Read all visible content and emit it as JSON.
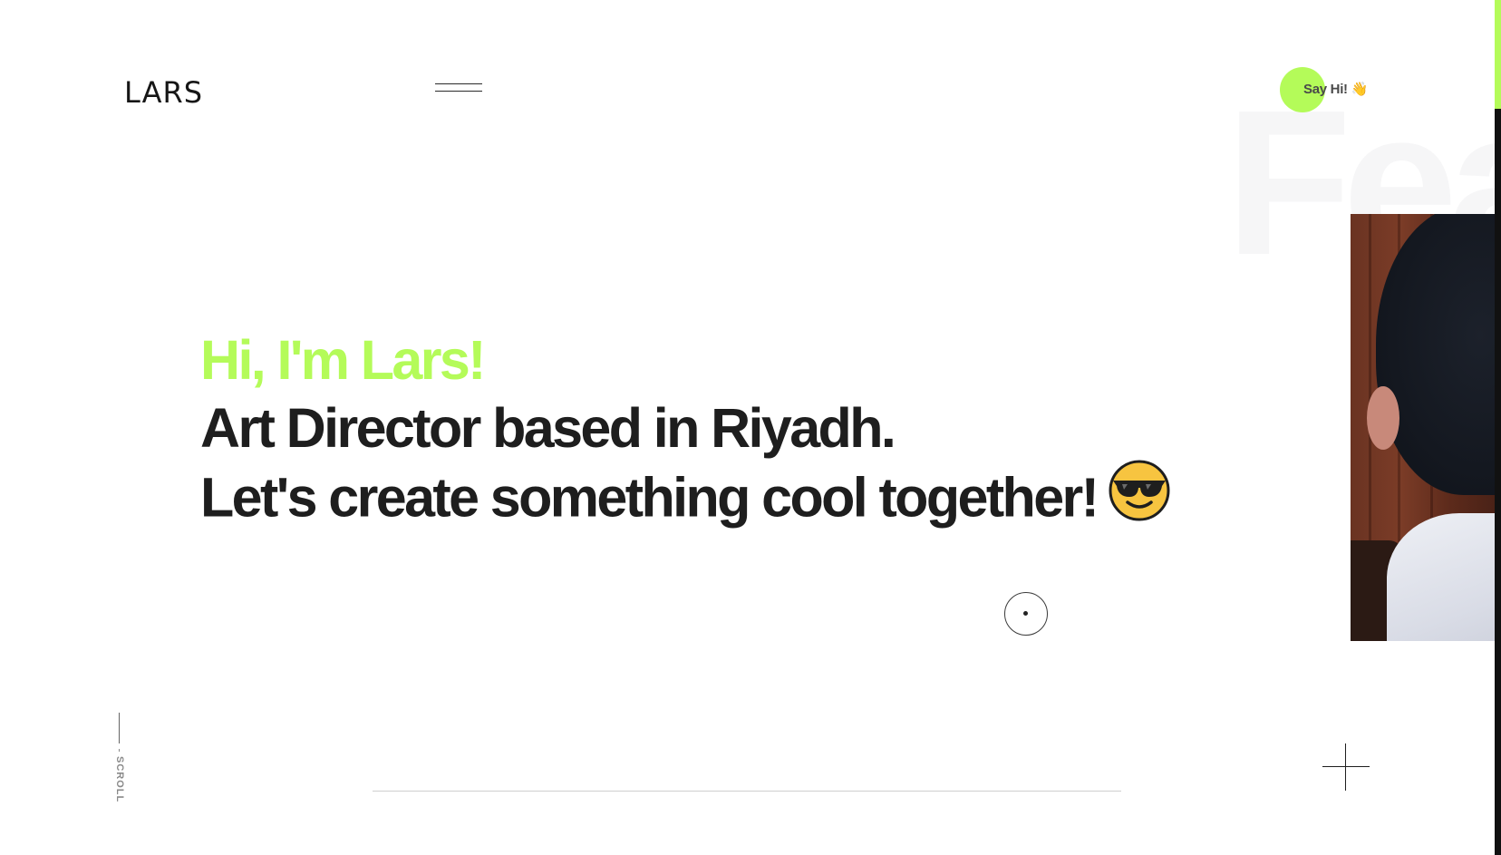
{
  "header": {
    "logo_text": "LARS",
    "menu_icon": "hamburger-icon",
    "cta_label": "Say Hi!",
    "cta_icon": "👋"
  },
  "hero": {
    "greeting": "Hi, I'm Lars!",
    "line2": "Art Director based in Riyadh.",
    "line3": "Let's create something cool together!",
    "emoji_icon": "sunglasses-face-icon"
  },
  "featured": {
    "background_word": "Fea"
  },
  "scroll": {
    "label": "SCROLL"
  },
  "colors": {
    "accent": "#b4fb59",
    "text": "#1e1e1e",
    "background": "#ffffff"
  }
}
